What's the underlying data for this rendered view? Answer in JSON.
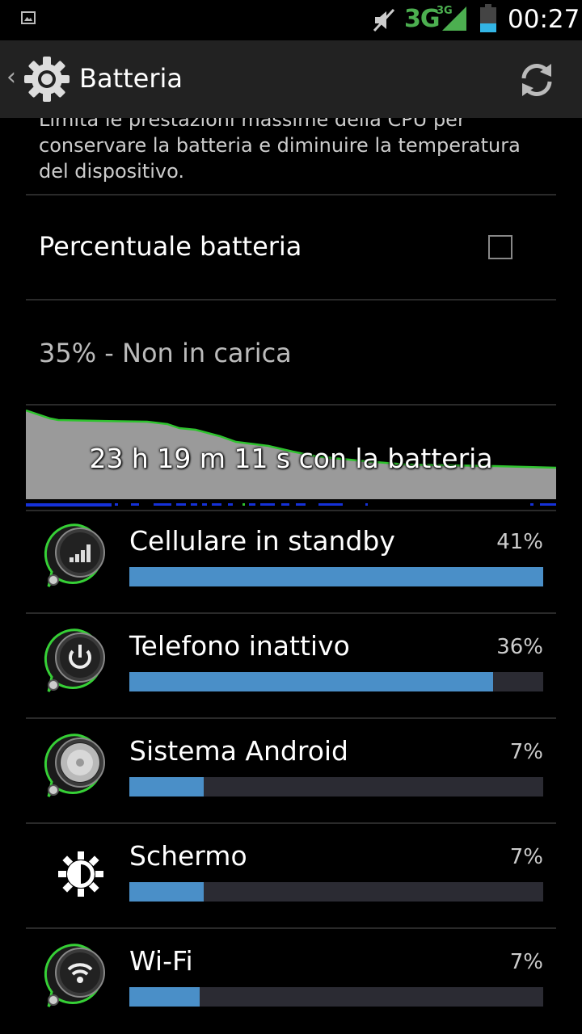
{
  "status_bar": {
    "network": "3G",
    "network_small": "3G",
    "time": "00:27",
    "battery_level": 0.35,
    "icons": [
      "image-notification-icon",
      "mute-icon",
      "signal-icon",
      "battery-icon"
    ]
  },
  "action_bar": {
    "title": "Batteria",
    "icons": [
      "back-chevron-icon",
      "settings-gear-icon",
      "refresh-icon"
    ]
  },
  "preferences": {
    "cpu_limit_summary": "Limita le prestazioni massime della CPU per conservare la batteria e diminuire la temperatura del dispositivo.",
    "battery_percentage_label": "Percentuale batteria",
    "battery_percentage_checked": false,
    "battery_status": "35% - Non in carica"
  },
  "graph": {
    "label": "23 h 19 m 11 s con la batteria"
  },
  "usage": [
    {
      "name": "Cellulare in standby",
      "percent_label": "41%",
      "fraction": 1.0,
      "icon": "cell-signal-icon"
    },
    {
      "name": "Telefono inattivo",
      "percent_label": "36%",
      "fraction": 0.878,
      "icon": "power-icon"
    },
    {
      "name": "Sistema Android",
      "percent_label": "7%",
      "fraction": 0.18,
      "icon": "android-system-icon"
    },
    {
      "name": "Schermo",
      "percent_label": "7%",
      "fraction": 0.18,
      "icon": "brightness-icon"
    },
    {
      "name": "Wi-Fi",
      "percent_label": "7%",
      "fraction": 0.17,
      "icon": "wifi-icon"
    }
  ]
}
